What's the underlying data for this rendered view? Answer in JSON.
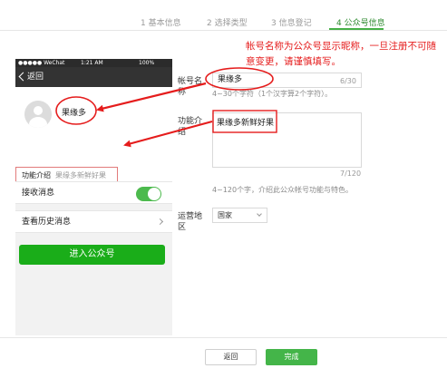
{
  "steps": [
    {
      "label": "1 基本信息",
      "active": false
    },
    {
      "label": "2 选择类型",
      "active": false
    },
    {
      "label": "3 信息登记",
      "active": false
    },
    {
      "label": "4 公众号信息",
      "active": true
    }
  ],
  "annotation": {
    "text": "帐号名称为公众号显示昵称，一旦注册不可随意变更，请谨慎填写。"
  },
  "preview": {
    "status_bar": {
      "carrier": "●●●●● WeChat",
      "time": "1:21 AM",
      "battery": "100%"
    },
    "back_label": "返回",
    "account_name": "果缘多",
    "intro_label": "功能介绍",
    "intro_value": "果缘多新鲜好果",
    "receive_messages_label": "接收消息",
    "receive_messages_on": true,
    "history_label": "查看历史消息",
    "enter_button": "进入公众号"
  },
  "form": {
    "name_label": "帐号名称",
    "name_value": "果缘多",
    "name_counter": "6/30",
    "name_hint": "4~30个字符（1个汉字算2个字符）。",
    "intro_label": "功能介绍",
    "intro_value": "果缘多新鲜好果",
    "intro_counter": "7/120",
    "intro_hint": "4~120个字，介绍此公众帐号功能与特色。",
    "region_label": "运营地区",
    "region_value": "国家"
  },
  "footer": {
    "back_button": "返回",
    "done_button": "完成"
  },
  "colors": {
    "accent_green": "#44b549",
    "annotation_red": "#e51c1c"
  }
}
